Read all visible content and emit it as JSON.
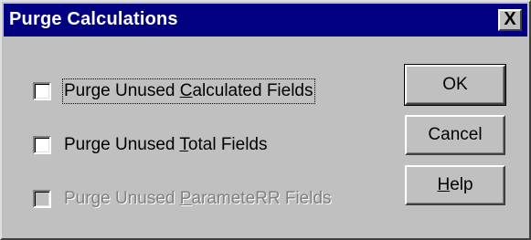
{
  "window": {
    "title": "Purge Calculations",
    "close_glyph": "X"
  },
  "options": [
    {
      "label_pre": "Purge Unused ",
      "label_key": "C",
      "label_post": "alculated Fields",
      "checked": false,
      "enabled": true,
      "focused": true
    },
    {
      "label_pre": "Purge Unused ",
      "label_key": "T",
      "label_post": "otal Fields",
      "checked": false,
      "enabled": true,
      "focused": false
    },
    {
      "label_pre": "Purge Unused ",
      "label_key": "P",
      "label_post": "arameteRR Fields",
      "checked": false,
      "enabled": false,
      "focused": false
    }
  ],
  "buttons": {
    "ok": {
      "label": "OK"
    },
    "cancel": {
      "label": "Cancel"
    },
    "help": {
      "label_key": "H",
      "label_post": "elp"
    }
  },
  "colors": {
    "titlebar": "#000080",
    "face": "#c0c0c0",
    "disabled_text": "#808080"
  }
}
